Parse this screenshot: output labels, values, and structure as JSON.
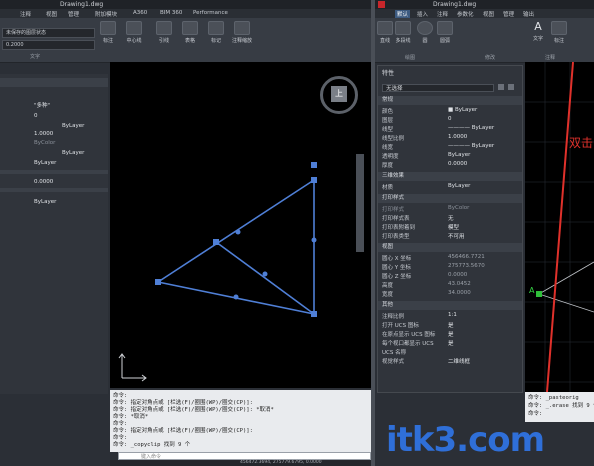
{
  "left_window": {
    "title": "Drawing1.dwg",
    "menu": [
      "注释",
      "视图",
      "管理",
      "附加模块",
      "A360",
      "BIM 360",
      "Performance"
    ],
    "ribbon": {
      "layer_combo": "未保存的图层状态",
      "lineweight_value": "0.2000",
      "panel_label": "文字",
      "buttons": [
        "标注",
        "中心线",
        "引线",
        "表格",
        "标记",
        "注释缩放"
      ]
    },
    "properties": {
      "rows": [
        {
          "name": "",
          "value": "\"多种\""
        },
        {
          "name": "",
          "value": "0"
        },
        {
          "name": "",
          "value": "ByLayer"
        },
        {
          "name": "",
          "value": "1.0000"
        },
        {
          "name": "",
          "value": "ByColor"
        },
        {
          "name": "",
          "value": "ByLayer"
        },
        {
          "name": "",
          "value": "ByLayer"
        },
        {
          "name": "",
          "value": "0.0000"
        },
        {
          "name": "",
          "value": "ByLayer"
        }
      ]
    },
    "view_cube": {
      "label": "上"
    },
    "command_history": [
      "命令:",
      "命令: 指定对角点或 [栏选(F)/圈围(WP)/圈交(CP)]:",
      "命令: 指定对角点或 [栏选(F)/圈围(WP)/圈交(CP)]: *取消*",
      "命令: *取消*",
      "命令:",
      "命令: 指定对角点或 [栏选(F)/圈围(WP)/圈交(CP)]:",
      "命令:",
      "命令: _copyclip 找到 9 个"
    ],
    "command_prompt": "键入命令",
    "status_coords": "456472.3694, 275779.6795, 0.0000"
  },
  "right_window": {
    "title": "Drawing1.dwg",
    "menu": [
      "默认",
      "插入",
      "注释",
      "参数化",
      "视图",
      "管理",
      "输出"
    ],
    "ribbon": {
      "buttons": [
        "直线",
        "多段线",
        "圆",
        "圆弧",
        "文字",
        "标注"
      ],
      "group_labels": [
        "绘图",
        "修改",
        "注释"
      ]
    },
    "properties_panel": {
      "title": "特性",
      "selection": "无选择",
      "sections": [
        {
          "header": "常规",
          "rows": [
            {
              "name": "颜色",
              "value": "■ ByLayer"
            },
            {
              "name": "图层",
              "value": "0"
            },
            {
              "name": "线型",
              "value": "———— ByLayer"
            },
            {
              "name": "线型比例",
              "value": "1.0000"
            },
            {
              "name": "线宽",
              "value": "———— ByLayer"
            },
            {
              "name": "透明度",
              "value": "ByLayer"
            },
            {
              "name": "厚度",
              "value": "0.0000"
            }
          ]
        },
        {
          "header": "三维效果",
          "rows": [
            {
              "name": "材质",
              "value": "ByLayer"
            }
          ]
        },
        {
          "header": "打印样式",
          "rows": [
            {
              "name": "打印样式",
              "value": "ByColor"
            },
            {
              "name": "打印样式表",
              "value": "无"
            },
            {
              "name": "打印表附着到",
              "value": "模型"
            },
            {
              "name": "打印表类型",
              "value": "不可用"
            }
          ]
        },
        {
          "header": "视图",
          "rows": [
            {
              "name": "圆心 X 坐标",
              "value": "456466.7721"
            },
            {
              "name": "圆心 Y 坐标",
              "value": "275773.5670"
            },
            {
              "name": "圆心 Z 坐标",
              "value": "0.0000"
            },
            {
              "name": "高度",
              "value": "43.0452"
            },
            {
              "name": "宽度",
              "value": "34.0000"
            }
          ]
        },
        {
          "header": "其他",
          "rows": [
            {
              "name": "注释比例",
              "value": "1:1"
            },
            {
              "name": "打开 UCS 图标",
              "value": "是"
            },
            {
              "name": "在原点显示 UCS 图标",
              "value": "是"
            },
            {
              "name": "每个视口都显示 UCS",
              "value": "是"
            },
            {
              "name": "UCS 名称",
              "value": ""
            },
            {
              "name": "视觉样式",
              "value": "二维线框"
            }
          ]
        }
      ]
    },
    "annotation_text": "双击",
    "point_label": "A",
    "command_history": [
      "命令: _pasteorig",
      "命令: _.erase 找到 9 个",
      "命令:"
    ],
    "watermark": "itk3.com"
  },
  "colors": {
    "accent_line": "#4f7fd6",
    "red_annotation": "#e0312b",
    "canvas_bg": "#000000",
    "watermark": "#2f6fd8"
  }
}
